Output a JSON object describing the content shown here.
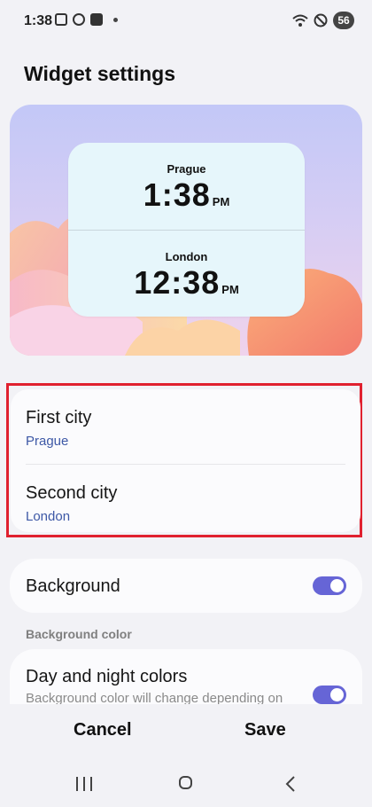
{
  "status_bar": {
    "time": "1:38",
    "battery": "56"
  },
  "title": "Widget settings",
  "preview": {
    "clocks": [
      {
        "city": "Prague",
        "time": "1:38",
        "ampm": "PM"
      },
      {
        "city": "London",
        "time": "12:38",
        "ampm": "PM"
      }
    ]
  },
  "cities": {
    "first": {
      "label": "First city",
      "value": "Prague"
    },
    "second": {
      "label": "Second city",
      "value": "London"
    }
  },
  "background": {
    "label": "Background",
    "enabled": true
  },
  "background_color": {
    "section_label": "Background color",
    "option_label": "Day and night colors",
    "option_desc": "Background color will change depending on",
    "enabled": true
  },
  "actions": {
    "cancel": "Cancel",
    "save": "Save"
  },
  "colors": {
    "accent": "#6665d6",
    "highlight": "#e0212f",
    "city_value": "#3d58a6"
  },
  "icons": [
    "recent-apps-icon",
    "home-icon",
    "back-icon"
  ]
}
